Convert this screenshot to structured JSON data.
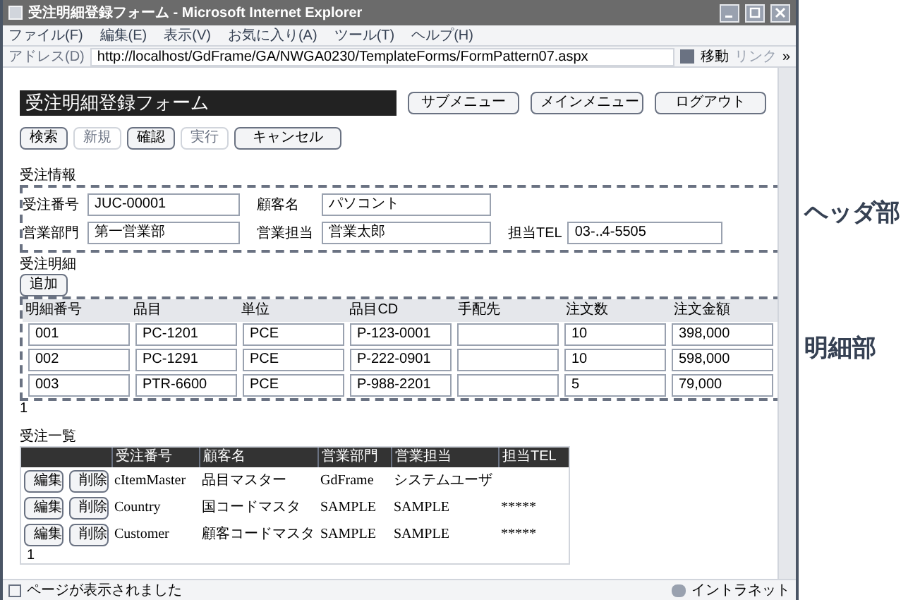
{
  "window": {
    "title": "受注明細登録フォーム - Microsoft Internet Explorer"
  },
  "menu": [
    "ファイル(F)",
    "編集(E)",
    "表示(V)",
    "お気に入り(A)",
    "ツール(T)",
    "ヘルプ(H)"
  ],
  "address": {
    "label": "アドレス(D)",
    "url": "http://localhost/GdFrame/GA/NWGA0230/TemplateForms/FormPattern07.aspx",
    "go": "移動",
    "links": "リンク",
    "more": "»"
  },
  "page_title": "受注明細登録フォーム",
  "nav_buttons": [
    "サブメニュー",
    "メインメニュー",
    "ログアウト"
  ],
  "actions": [
    {
      "label": "検索",
      "disabled": false
    },
    {
      "label": "新規",
      "disabled": true
    },
    {
      "label": "確認",
      "disabled": false
    },
    {
      "label": "実行",
      "disabled": true
    },
    {
      "label": "キャンセル",
      "disabled": false
    }
  ],
  "header": {
    "title": "受注情報",
    "fields": [
      {
        "label": "受注番号",
        "value": "JUC-00001"
      },
      {
        "label": "顧客名",
        "value": "パソコント"
      },
      {
        "label": "営業部門",
        "value": "第一営業部"
      },
      {
        "label": "営業担当",
        "value": "営業太郎"
      },
      {
        "label": "担当TEL",
        "value": "03-‥4-5505"
      }
    ]
  },
  "detail": {
    "title": "受注明細",
    "add_button": "追加",
    "columns": [
      "明細番号",
      "品目",
      "単位",
      "品目CD",
      "手配先",
      "注文数",
      "注文金額"
    ],
    "rows": [
      [
        "001",
        "PC-1201",
        "PCE",
        "P-123-0001",
        "",
        "10",
        "398,000"
      ],
      [
        "002",
        "PC-1291",
        "PCE",
        "P-222-0901",
        "",
        "10",
        "598,000"
      ],
      [
        "003",
        "PTR-6600",
        "PCE",
        "P-988-2201",
        "",
        "5",
        "79,000"
      ]
    ],
    "pager": "1"
  },
  "list": {
    "title": "受注一覧",
    "columns": [
      "受注番号",
      "顧客名",
      "営業部門",
      "営業担当",
      "担当TEL"
    ],
    "rows": [
      {
        "edit": "編集",
        "delete": "削除",
        "cells": [
          "cItemMaster",
          "品目マスター",
          "GdFrame",
          "システムユーザ",
          ""
        ]
      },
      {
        "edit": "編集",
        "delete": "削除",
        "cells": [
          "Country",
          "国コードマスタ",
          "SAMPLE",
          "SAMPLE",
          "*****"
        ]
      },
      {
        "edit": "編集",
        "delete": "削除",
        "cells": [
          "Customer",
          "顧客コードマスタ",
          "SAMPLE",
          "SAMPLE",
          "*****"
        ]
      }
    ],
    "pager": "1"
  },
  "status_bar": {
    "message": "ページが表示されました",
    "zone": "イントラネット"
  },
  "callouts": [
    "ヘッダ部",
    "明細部"
  ]
}
